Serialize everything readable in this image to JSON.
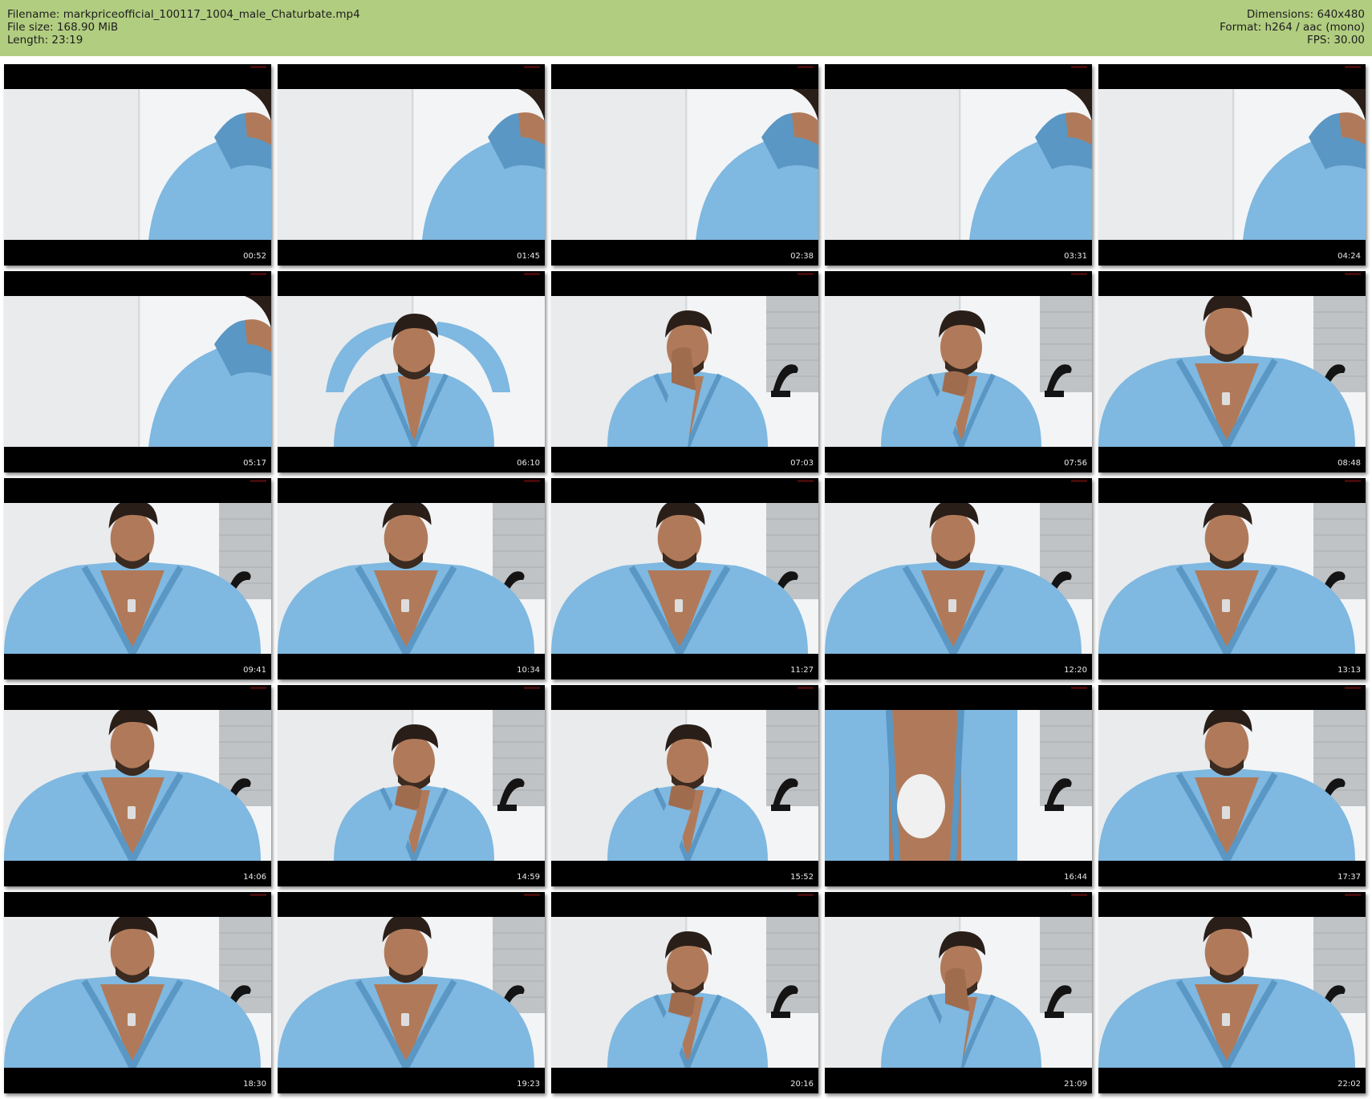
{
  "header": {
    "filename_line": "Filename: markpriceofficial_100117_1004_male_Chaturbate.mp4",
    "filesize_line": "File size: 168.90 MiB",
    "length_line": "Length: 23:19",
    "dimensions_line": "Dimensions: 640x480",
    "format_line": "Format: h264 / aac (mono)",
    "fps_line": "FPS: 30.00",
    "bg_color": "#b1cd80"
  },
  "thumbnails": [
    {
      "timestamp": "00:52",
      "scene": "shoulder"
    },
    {
      "timestamp": "01:45",
      "scene": "shoulder"
    },
    {
      "timestamp": "02:38",
      "scene": "shoulder"
    },
    {
      "timestamp": "03:31",
      "scene": "shoulder"
    },
    {
      "timestamp": "04:24",
      "scene": "shoulder"
    },
    {
      "timestamp": "05:17",
      "scene": "shoulder"
    },
    {
      "timestamp": "06:10",
      "scene": "arms-up"
    },
    {
      "timestamp": "07:03",
      "scene": "hand-face"
    },
    {
      "timestamp": "07:56",
      "scene": "hand-chin"
    },
    {
      "timestamp": "08:48",
      "scene": "closeup"
    },
    {
      "timestamp": "09:41",
      "scene": "closeup"
    },
    {
      "timestamp": "10:34",
      "scene": "closeup"
    },
    {
      "timestamp": "11:27",
      "scene": "closeup"
    },
    {
      "timestamp": "12:20",
      "scene": "closeup"
    },
    {
      "timestamp": "13:13",
      "scene": "closeup"
    },
    {
      "timestamp": "14:06",
      "scene": "closeup"
    },
    {
      "timestamp": "14:59",
      "scene": "hand-chin"
    },
    {
      "timestamp": "15:52",
      "scene": "hand-chin"
    },
    {
      "timestamp": "16:44",
      "scene": "robe-body"
    },
    {
      "timestamp": "17:37",
      "scene": "closeup"
    },
    {
      "timestamp": "18:30",
      "scene": "closeup"
    },
    {
      "timestamp": "19:23",
      "scene": "closeup"
    },
    {
      "timestamp": "20:16",
      "scene": "hand-chin"
    },
    {
      "timestamp": "21:09",
      "scene": "hand-face"
    },
    {
      "timestamp": "22:02",
      "scene": "closeup"
    }
  ],
  "colors": {
    "robe": "#7fb8e0",
    "robe_dark": "#5a97c4",
    "wall": "#e9ebed",
    "skin": "#b07a5a",
    "hair": "#2a1e18"
  }
}
